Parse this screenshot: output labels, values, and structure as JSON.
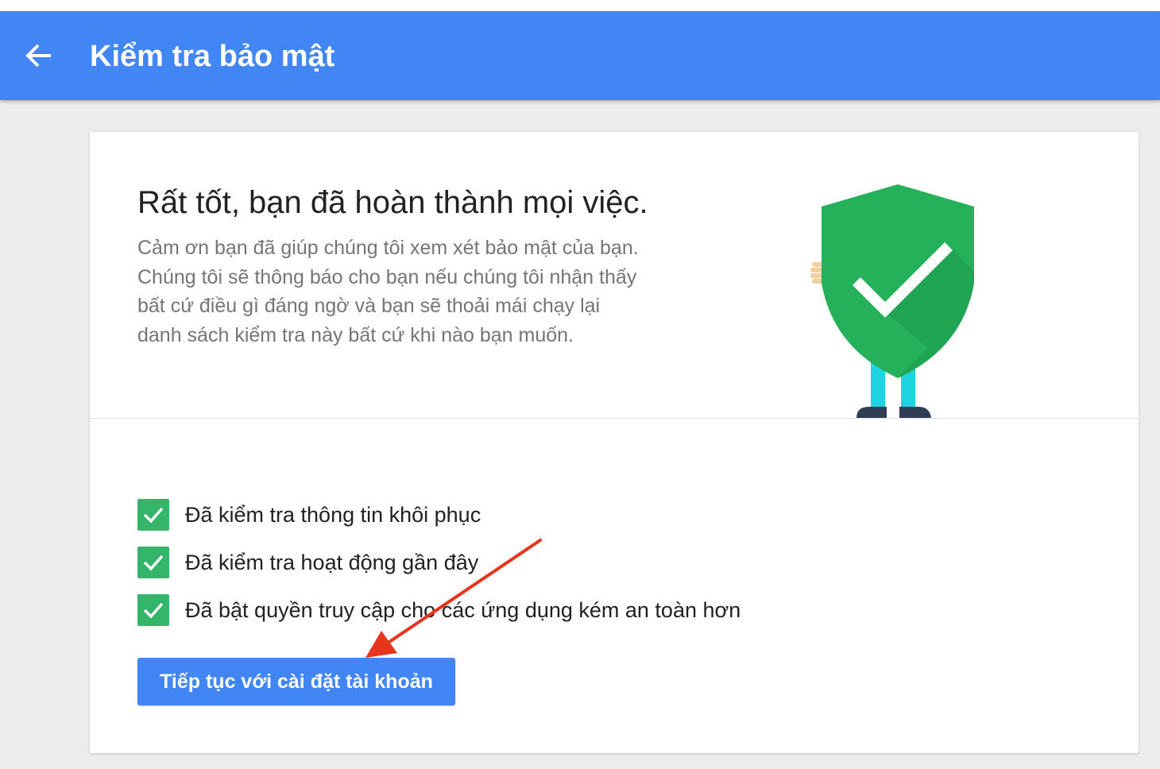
{
  "header": {
    "title": "Kiểm tra bảo mật",
    "back_icon": "arrow-back-icon",
    "background_color": "#4285f4"
  },
  "summary": {
    "headline": "Rất tốt, bạn đã hoàn thành mọi việc.",
    "description": "Cảm ơn bạn đã giúp chúng tôi xem xét bảo mật của bạn. Chúng tôi sẽ thông báo cho bạn nếu chúng tôi nhận thấy bất cứ điều gì đáng ngờ và bạn sẽ thoải mái chạy lại danh sách kiểm tra này bất cứ khi nào bạn muốn.",
    "illustration": "shield-checkmark-character-icon",
    "shield_color": "#25b159"
  },
  "checklist": {
    "items": [
      {
        "label": "Đã kiểm tra thông tin khôi phục",
        "checked": true
      },
      {
        "label": "Đã kiểm tra hoạt động gần đây",
        "checked": true
      },
      {
        "label": "Đã bật quyền truy cập cho các ứng dụng kém an toàn hơn",
        "checked": true
      }
    ],
    "check_color": "#34b56a"
  },
  "actions": {
    "continue_label": "Tiếp tục với cài đặt tài khoản",
    "button_color": "#4285f4"
  },
  "annotation": {
    "arrow_color": "#e8341c",
    "points_to": "continue-button"
  }
}
